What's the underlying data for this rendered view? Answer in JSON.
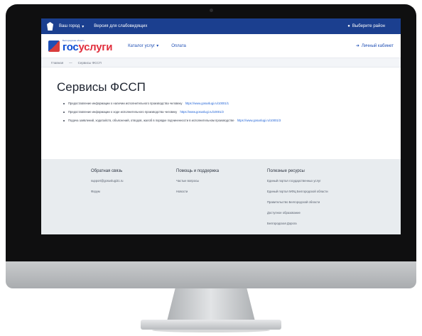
{
  "topbar": {
    "region": "Ваш город",
    "accessibility": "Версия для слабовидящих",
    "location": "Выберите район"
  },
  "header": {
    "logo_small": "Белгородская область",
    "logo_gos": "гос",
    "logo_uslugi": "услуги",
    "nav_catalog": "Каталог услуг",
    "nav_payment": "Оплата",
    "account": "Личный кабинет"
  },
  "breadcrumbs": {
    "home": "Главная",
    "current": "Сервисы ФССП"
  },
  "main": {
    "title": "Сервисы ФССП",
    "services": [
      {
        "text": "Предоставление информации о наличии исполнительного производства человеку",
        "link": "https://www.gosuslugi.ru/10001/1"
      },
      {
        "text": "Предоставление информации о ходе исполнительного производства человеку",
        "link": "https://www.gosuslugi.ru/10001/2"
      },
      {
        "text": "Подача заявлений, ходатайств, объяснений, отводов, жалоб в порядке подчиненности в исполнительном производстве",
        "link": "https://www.gosuslugi.ru/10001/3"
      }
    ]
  },
  "footer": {
    "feedback": {
      "title": "Обратная связь",
      "items": [
        "support@gosuslugi31.ru",
        "Форум"
      ]
    },
    "help": {
      "title": "Помощь и поддержка",
      "items": [
        "Частые вопросы",
        "Новости"
      ]
    },
    "resources": {
      "title": "Полезные ресурсы",
      "items": [
        "Единый портал государственных услуг",
        "Единый портал МФЦ Белгородской области",
        "Правительство Белгородской области",
        "Доступное образование",
        "Белгородская Дорога"
      ]
    }
  },
  "colors": {
    "topbar": "#1b3f8f",
    "link": "#1f62d6",
    "footer_bg": "#e8ecef"
  }
}
